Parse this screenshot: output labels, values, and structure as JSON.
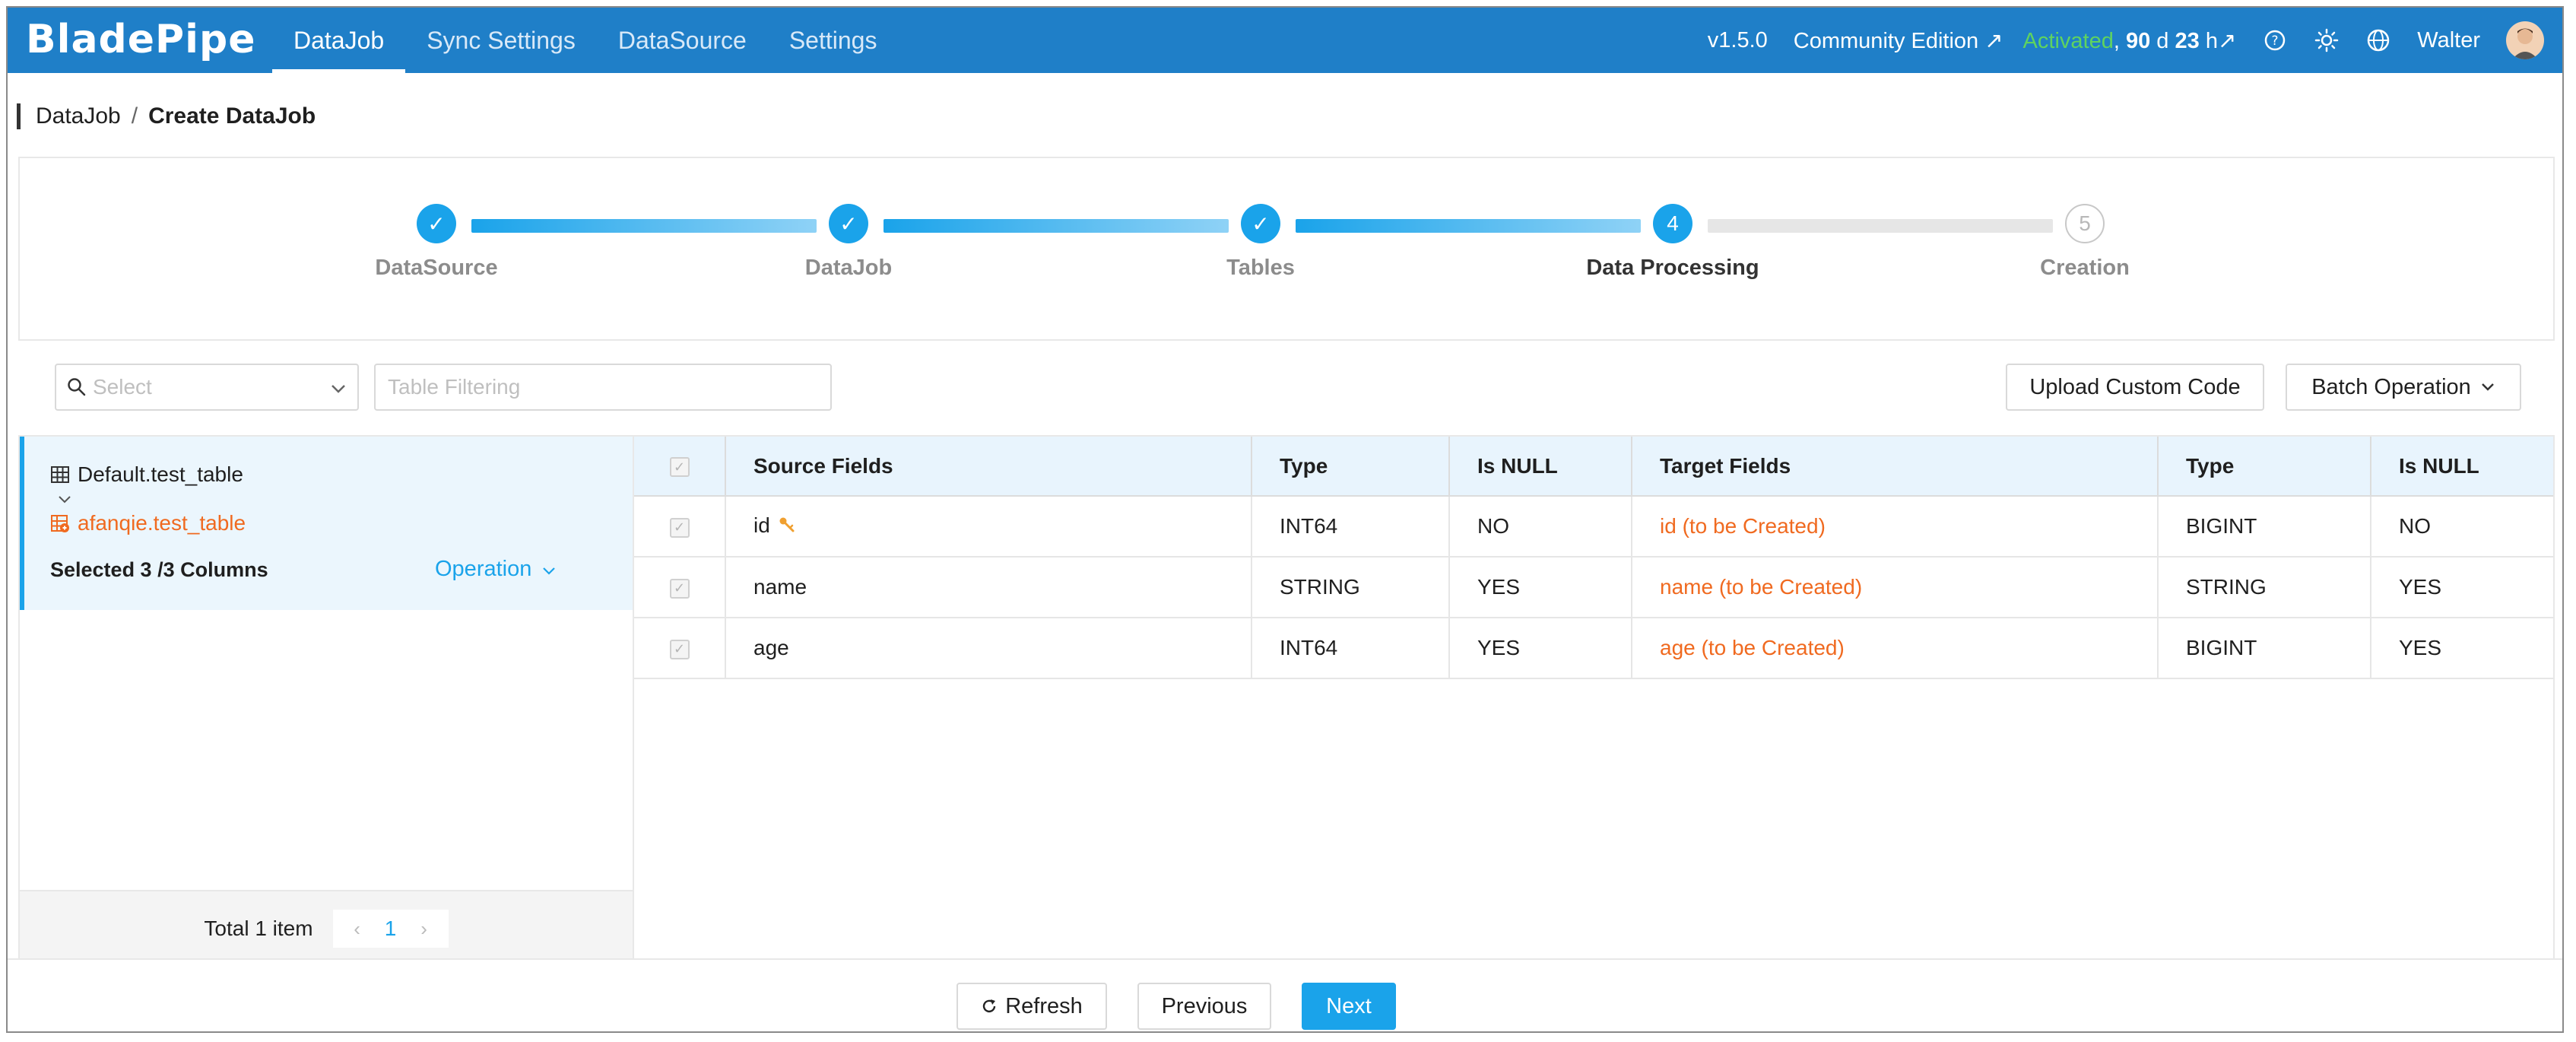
{
  "app": {
    "logo": "BladePipe"
  },
  "nav": {
    "items": [
      {
        "label": "DataJob",
        "active": true
      },
      {
        "label": "Sync Settings",
        "active": false
      },
      {
        "label": "DataSource",
        "active": false
      },
      {
        "label": "Settings",
        "active": false
      }
    ]
  },
  "topbar": {
    "version": "v1.5.0",
    "edition": "Community Edition",
    "edition_arrow": "↗",
    "activated": "Activated",
    "comma": ",",
    "days_value": "90",
    "days_unit": "d",
    "hours_value": "23",
    "hours_unit": "h",
    "license_arrow": "↗",
    "user": "Walter"
  },
  "breadcrumb": {
    "parent": "DataJob",
    "separator": "/",
    "current": "Create DataJob"
  },
  "steps": [
    {
      "label": "DataSource",
      "status": "done",
      "marker": "✓"
    },
    {
      "label": "DataJob",
      "status": "done",
      "marker": "✓"
    },
    {
      "label": "Tables",
      "status": "done",
      "marker": "✓"
    },
    {
      "label": "Data Processing",
      "status": "current",
      "marker": "4"
    },
    {
      "label": "Creation",
      "status": "pending",
      "marker": "5"
    }
  ],
  "toolbar": {
    "select_placeholder": "Select",
    "filter_placeholder": "Table Filtering",
    "upload_label": "Upload Custom Code",
    "batch_label": "Batch Operation"
  },
  "left": {
    "source_table": "Default.test_table",
    "target_table": "afanqie.test_table",
    "selected": "Selected 3 /3 Columns",
    "operation": "Operation",
    "total": "Total 1 item",
    "page": "1"
  },
  "grid": {
    "headers": [
      "Source Fields",
      "Type",
      "Is NULL",
      "Target Fields",
      "Type",
      "Is NULL"
    ],
    "rows": [
      {
        "source": "id",
        "stype": "INT64",
        "snull": "NO",
        "target": "id (to be Created)",
        "ttype": "BIGINT",
        "tnull": "NO",
        "key": true
      },
      {
        "source": "name",
        "stype": "STRING",
        "snull": "YES",
        "target": "name (to be Created)",
        "ttype": "STRING",
        "tnull": "YES",
        "key": false
      },
      {
        "source": "age",
        "stype": "INT64",
        "snull": "YES",
        "target": "age (to be Created)",
        "ttype": "BIGINT",
        "tnull": "YES",
        "key": false
      }
    ]
  },
  "footer": {
    "refresh": "Refresh",
    "previous": "Previous",
    "next": "Next"
  },
  "colors": {
    "nav_bg": "#1f7fc8",
    "accent": "#1aa3ea",
    "warning_orange": "#f06a20",
    "activated_green": "#5fd35f"
  }
}
